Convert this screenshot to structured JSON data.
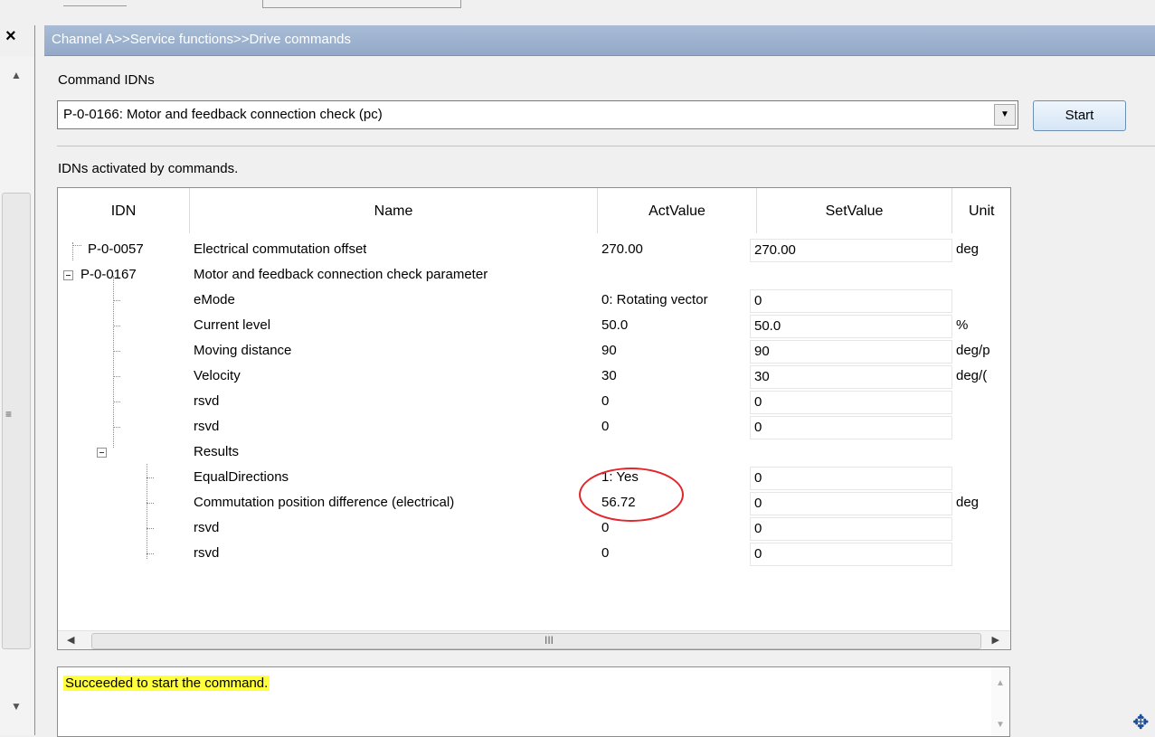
{
  "header": {
    "breadcrumb": "Channel A>>Service functions>>Drive commands"
  },
  "command": {
    "label": "Command IDNs",
    "selected": "P-0-0166: Motor and feedback connection check (pc)",
    "start_label": "Start"
  },
  "grid": {
    "caption": "IDNs activated by commands.",
    "columns": [
      "IDN",
      "Name",
      "ActValue",
      "SetValue",
      "Unit"
    ],
    "rows": [
      {
        "idn": "P-0-0057",
        "name": "Electrical commutation offset",
        "act": "270.00",
        "set": "270.00",
        "unit": "deg"
      },
      {
        "idn": "P-0-0167",
        "name": "Motor and feedback connection check parameter",
        "act": "",
        "set": "",
        "unit": ""
      },
      {
        "idn": "",
        "name": "eMode",
        "act": "0: Rotating vector",
        "set": "0",
        "unit": ""
      },
      {
        "idn": "",
        "name": "Current level",
        "act": "50.0",
        "set": "50.0",
        "unit": "%"
      },
      {
        "idn": "",
        "name": "Moving distance",
        "act": "90",
        "set": "90",
        "unit": "deg/p"
      },
      {
        "idn": "",
        "name": "Velocity",
        "act": "30",
        "set": "30",
        "unit": "deg/("
      },
      {
        "idn": "",
        "name": "rsvd",
        "act": "0",
        "set": "0",
        "unit": ""
      },
      {
        "idn": "",
        "name": "rsvd",
        "act": "0",
        "set": "0",
        "unit": ""
      },
      {
        "idn": "",
        "name": "Results",
        "act": "",
        "set": "",
        "unit": ""
      },
      {
        "idn": "",
        "name": "EqualDirections",
        "act": "1: Yes",
        "set": "0",
        "unit": ""
      },
      {
        "idn": "",
        "name": "Commutation position difference (electrical)",
        "act": "56.72",
        "set": "0",
        "unit": "deg"
      },
      {
        "idn": "",
        "name": "rsvd",
        "act": "0",
        "set": "0",
        "unit": ""
      },
      {
        "idn": "",
        "name": "rsvd",
        "act": "0",
        "set": "0",
        "unit": ""
      }
    ],
    "hscroll_grip": "III"
  },
  "status": {
    "message": "Succeeded to start the command."
  },
  "icons": {
    "close": "close-icon",
    "dropdown": "chevron-down-icon",
    "move": "move-icon"
  },
  "colors": {
    "header_bg": "#9fb4d1",
    "highlight": "#ffff3c",
    "annotation": "#e3262b"
  }
}
